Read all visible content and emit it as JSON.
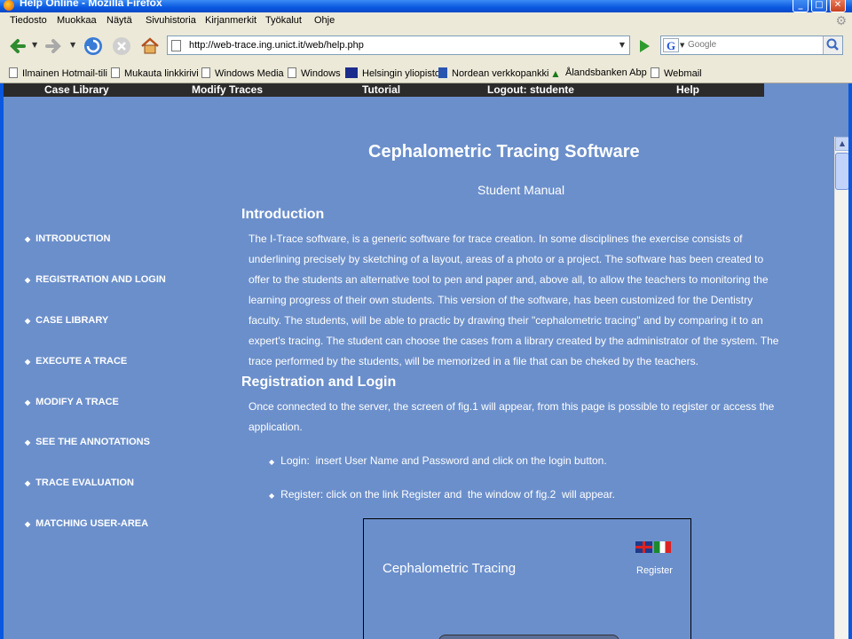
{
  "window": {
    "title": "Help Online - Mozilla Firefox"
  },
  "menu": [
    "Tiedosto",
    "Muokkaa",
    "Näytä",
    "Sivuhistoria",
    "Kirjanmerkit",
    "Työkalut",
    "Ohje"
  ],
  "address": {
    "url": "http://web-trace.ing.unict.it/web/help.php"
  },
  "search": {
    "engine_letter": "G",
    "placeholder": "Google"
  },
  "bookmarks": [
    "Ilmainen Hotmail-tili",
    "Mukauta linkkirivi",
    "Windows Media",
    "Windows",
    "Helsingin yliopisto",
    "Nordean verkkopankki",
    "Ålandsbanken Abp",
    "Webmail"
  ],
  "site_nav": [
    "Case Library",
    "Modify Traces",
    "Tutorial",
    "Logout: studente",
    "Help"
  ],
  "page": {
    "title": "Cephalometric Tracing Software",
    "subtitle": "Student Manual",
    "intro_heading": "Introduction",
    "intro_lines": [
      "The I-Trace software, is a generic software for trace creation. In some disciplines the exercise consists of",
      "underlining precisely by sketching of a layout, areas of a photo or a project. The software has been created to",
      "offer to the students an alternative tool to pen and paper and, above all, to allow the teachers to monitoring the",
      "learning progress of their own students. This version of the software, has been customized for the Dentistry",
      "faculty. The students, will be able to practic by drawing their \"cephalometric tracing\" and by comparing it to an",
      "expert's tracing. The student can choose the cases from a library created by the administrator of the system. The",
      "trace performed by the students, will be memorized in a file that can be cheked by the teachers."
    ],
    "reg_heading": "Registration and Login",
    "reg_lines": [
      "Once connected to the server, the screen of fig.1 will appear, from this page is possible to register or access the",
      "application."
    ],
    "bullets": [
      "Login:  insert User Name and Password and click on the login button.",
      "Register: click on the link Register and  the window of fig.2  will appear."
    ]
  },
  "sidebar": [
    "INTRODUCTION",
    "REGISTRATION AND LOGIN",
    "CASE LIBRARY",
    "EXECUTE A TRACE",
    "MODIFY A TRACE",
    "SEE THE ANNOTATIONS",
    "TRACE EVALUATION",
    "MATCHING USER-AREA"
  ],
  "figure": {
    "title": "Cephalometric Tracing",
    "register": "Register"
  }
}
